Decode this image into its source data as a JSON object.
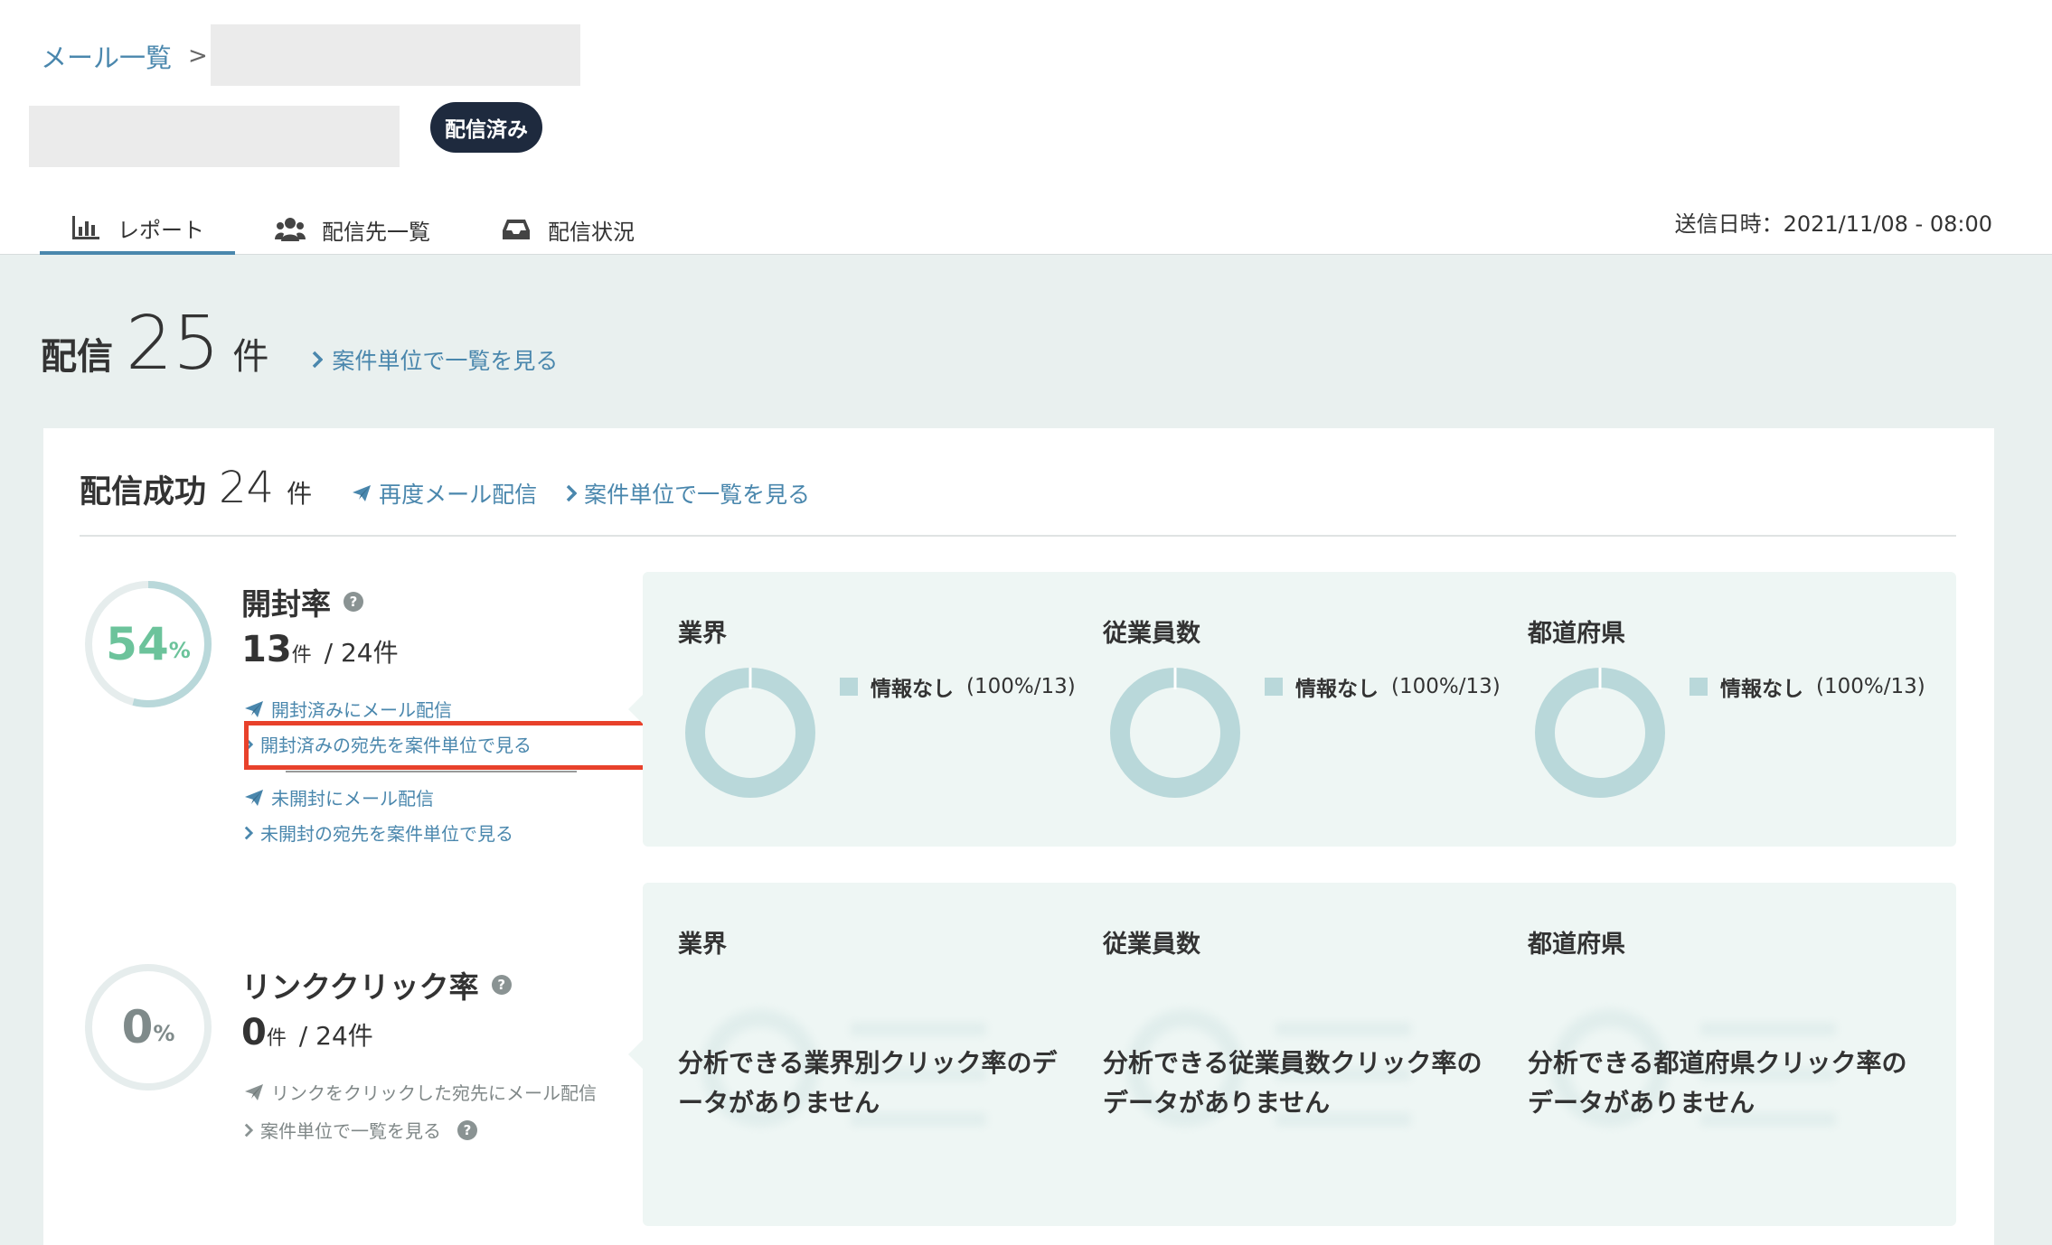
{
  "breadcrumb": {
    "root": "メール一覧",
    "separator": ">"
  },
  "status_badge": "配信済み",
  "tabs": [
    {
      "label": "レポート",
      "icon": "bar-chart-icon",
      "active": true
    },
    {
      "label": "配信先一覧",
      "icon": "users-icon",
      "active": false
    },
    {
      "label": "配信状況",
      "icon": "inbox-icon",
      "active": false
    }
  ],
  "sent_at": "送信日時：2021/11/08 - 08:00",
  "summary": {
    "label": "配信",
    "count": "25",
    "unit": "件",
    "link": "案件単位で一覧を見る"
  },
  "success": {
    "label": "配信成功",
    "count": "24",
    "unit": "件",
    "resend_link": "再度メール配信",
    "list_link": "案件単位で一覧を見る"
  },
  "open_rate": {
    "value": "54",
    "unit": "%",
    "fraction": 0.54,
    "title": "開封率",
    "count": "13",
    "count_unit": "件",
    "total": "/ 24件",
    "links": [
      "開封済みにメール配信",
      "開封済みの宛先を案件単位で見る",
      "未開封にメール配信",
      "未開封の宛先を案件単位で見る"
    ]
  },
  "click_rate": {
    "value": "0",
    "unit": "%",
    "fraction": 0,
    "title": "リンククリック率",
    "count": "0",
    "count_unit": "件",
    "total": "/ 24件",
    "links": [
      "リンクをクリックした宛先にメール配信",
      "案件単位で一覧を見る"
    ]
  },
  "breakdown_open": [
    {
      "title": "業界",
      "legend": "情報なし",
      "legend_pct": "(100%/13)"
    },
    {
      "title": "従業員数",
      "legend": "情報なし",
      "legend_pct": "(100%/13)"
    },
    {
      "title": "都道府県",
      "legend": "情報なし",
      "legend_pct": "(100%/13)"
    }
  ],
  "breakdown_click": [
    {
      "title": "業界",
      "nodata": "分析できる業界別クリック率のデータがありません"
    },
    {
      "title": "従業員数",
      "nodata": "分析できる従業員数クリック率のデータがありません"
    },
    {
      "title": "都道府県",
      "nodata": "分析できる都道府県クリック率のデータがありません"
    }
  ],
  "colors": {
    "accent": "#4a87ad",
    "open_ring": "#6cc39b",
    "donut": "#b9d8da",
    "highlight": "#e8412b"
  }
}
